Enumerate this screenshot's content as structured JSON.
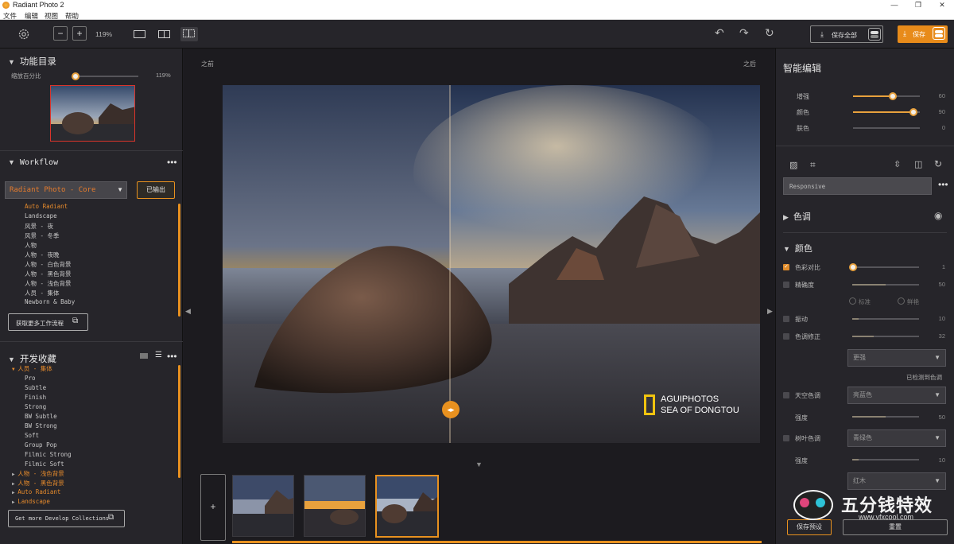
{
  "app": {
    "title": "Radiant Photo 2"
  },
  "menu": [
    "文件",
    "编辑",
    "视图",
    "帮助"
  ],
  "toolbar": {
    "zoom_minus": "−",
    "zoom_plus": "+",
    "zoom_level": "119%",
    "save_all_label": "保存全部",
    "save_label": "保存"
  },
  "left": {
    "catalog_title": "功能目录",
    "zoom_label": "缩放百分比",
    "zoom_value": "119%",
    "workflow_title": "Workflow",
    "workflow_select": "Radiant Photo - Core",
    "export_label": "已输出",
    "workflow_items": [
      "Auto Radiant",
      "Landscape",
      "风景 - 夜",
      "风景 - 冬季",
      "人物",
      "人物 - 夜晚",
      "人物 - 白色背景",
      "人物 - 黑色背景",
      "人物 - 浅色背景",
      "人员 - 集体",
      "Newborn & Baby"
    ],
    "more_workflows": "获取更多工作流程",
    "develop_title": "开发收藏",
    "group_expanded": "人员 - 集体",
    "develop_items": [
      "Pro",
      "Subtle",
      "Finish",
      "Strong",
      "BW Subtle",
      "BW Strong",
      "Soft",
      "Group Pop",
      "Filmic Strong",
      "Filmic Soft"
    ],
    "collapsed_groups": [
      "人物 - 浅色背景",
      "人物 - 黑色背景",
      "Auto Radiant",
      "Landscape"
    ],
    "more_collections": "Get more Develop Collections"
  },
  "center": {
    "before_label": "之前",
    "after_label": "之后",
    "watermark_line1": "AGUIPHOTOS",
    "watermark_line2": "SEA OF DONGTOU",
    "add_label": "+"
  },
  "right": {
    "title": "智能编辑",
    "smart_sliders": [
      {
        "label": "增强",
        "value": 60
      },
      {
        "label": "颜色",
        "value": 90
      },
      {
        "label": "肤色",
        "value": 0
      }
    ],
    "preset_input": "Responsive",
    "tone_section": "色调",
    "color_section": "颜色",
    "color_controls": [
      {
        "label": "色彩对比",
        "value": 1,
        "checked": true
      },
      {
        "label": "精确度",
        "value": 50,
        "checked": false
      },
      {
        "label": "振动",
        "value": 10,
        "checked": false
      },
      {
        "label": "色调修正",
        "value": 32,
        "checked": false
      }
    ],
    "radio_options": [
      "标准",
      "鲜艳"
    ],
    "color_fix_select": "更强",
    "detected_text": "已检测到色调",
    "sky_label": "天空色调",
    "sky_select": "亮蓝色",
    "sky_strength_label": "强度",
    "sky_strength_value": 50,
    "foliage_label": "树叶色调",
    "foliage_select": "青绿色",
    "foliage_strength_label": "强度",
    "foliage_strength_value": 10,
    "foliage_select2": "红木",
    "save_preset": "保存预设",
    "reset": "重置"
  },
  "overlay_watermark": "五分钱特效",
  "overlay_url": "www.vfxcool.com",
  "colors": {
    "accent": "#e88b1a",
    "panel": "#26252a",
    "bg": "#1c1b1f"
  }
}
